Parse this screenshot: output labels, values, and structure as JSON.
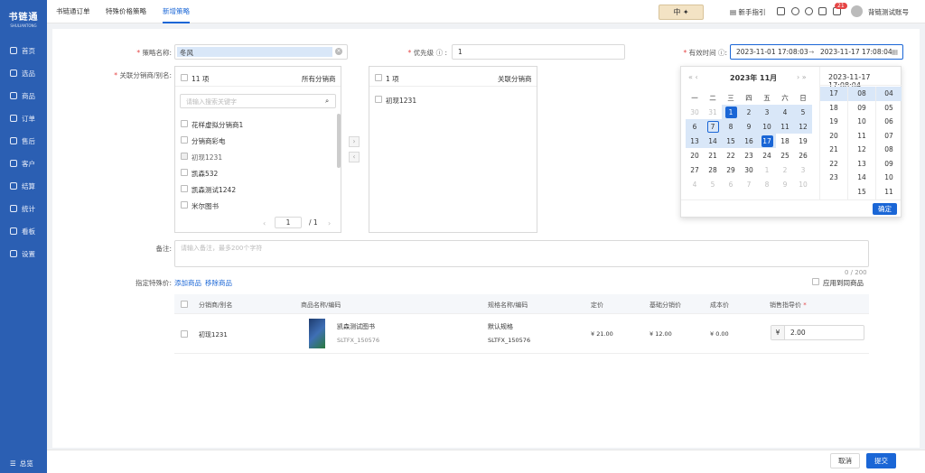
{
  "app": {
    "logo": "书链通",
    "logo_sub": "SHULIANTONG"
  },
  "sidebar": {
    "items": [
      "首页",
      "选品",
      "商品",
      "订单",
      "售后",
      "客户",
      "结算",
      "统计",
      "看板",
      "设置"
    ],
    "collapse": "总览"
  },
  "tabs": [
    "书链通订单",
    "特殊价格策略",
    "新增策略"
  ],
  "topbar": {
    "ime": "中",
    "guide": "新手指引",
    "badge": "21",
    "user": "背链测试账号"
  },
  "form": {
    "name_label": "策略名称:",
    "name_value": "冬风",
    "priority_label": "优先级",
    "priority_value": "1",
    "valid_label": "有效时间",
    "start": "2023-11-01 17:08:03",
    "arrow": "→",
    "end": "2023-11-17 17:08:04",
    "dist_label": "关联分销商/别名:",
    "remark_label": "备注:",
    "remark_placeholder": "请输入备注，最多200个字符",
    "remark_count": "0 / 200",
    "special_label": "指定特殊价:",
    "add_goods": "添加商品",
    "remove_goods": "移除商品",
    "apply_same": "应用到同商品"
  },
  "transfer": {
    "left_count": "11 项",
    "left_title": "所有分销商",
    "search_placeholder": "请输入搜索关键字",
    "left_items": [
      "花样虚拟分销商1",
      "分销商彩电",
      "初现1231",
      "凯森532",
      "凯森测试1242",
      "米尔图书"
    ],
    "page": "1",
    "page_total": "/ 1",
    "right_count": "1 项",
    "right_title": "关联分销商",
    "right_items": [
      "初现1231"
    ]
  },
  "calendar": {
    "prev": "«  ‹",
    "header": "2023年  11月",
    "next": "›  »",
    "weekdays": [
      "一",
      "二",
      "三",
      "四",
      "五",
      "六",
      "日"
    ],
    "weeks": [
      [
        "30",
        "31",
        "1",
        "2",
        "3",
        "4",
        "5"
      ],
      [
        "6",
        "7",
        "8",
        "9",
        "10",
        "11",
        "12"
      ],
      [
        "13",
        "14",
        "15",
        "16",
        "17",
        "18",
        "19"
      ],
      [
        "20",
        "21",
        "22",
        "23",
        "24",
        "25",
        "26"
      ],
      [
        "27",
        "28",
        "29",
        "30",
        "1",
        "2",
        "3"
      ],
      [
        "4",
        "5",
        "6",
        "7",
        "8",
        "9",
        "10"
      ]
    ],
    "time_title": "2023-11-17 17:08:04",
    "hours": [
      "17",
      "18",
      "19",
      "20",
      "21",
      "22",
      "23"
    ],
    "minutes": [
      "08",
      "09",
      "10",
      "11",
      "12",
      "13",
      "14",
      "15"
    ],
    "seconds": [
      "04",
      "05",
      "06",
      "07",
      "08",
      "09",
      "10",
      "11"
    ],
    "confirm": "确定"
  },
  "table": {
    "headers": [
      "分销商/别名",
      "商品名称/编码",
      "规格名称/编码",
      "定价",
      "基础分销价",
      "成本价",
      "销售指导价"
    ],
    "row": {
      "dist": "初现1231",
      "name": "凯森测试图书",
      "code": "SLTFX_150576",
      "spec": "默认规格",
      "spec_code": "SLTFX_150576",
      "price": "¥ 21.00",
      "base": "¥ 12.00",
      "cost": "¥ 0.00",
      "currency": "¥",
      "guide": "2.00"
    }
  },
  "footer": {
    "cancel": "取消",
    "submit": "提交"
  },
  "colors": {
    "primary": "#1a66d6",
    "sidebar": "#2b5fb3",
    "range": "#d9e7f8"
  }
}
